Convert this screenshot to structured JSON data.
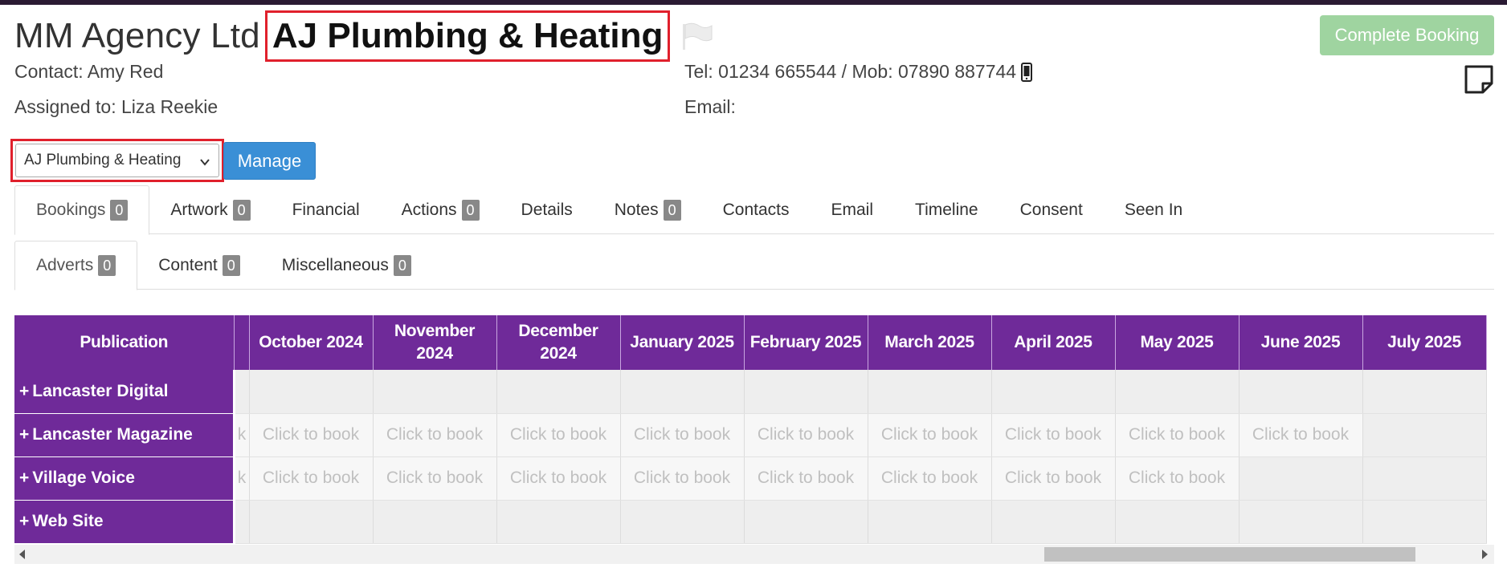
{
  "header": {
    "agency_name": "MM Agency Ltd",
    "client_name": "AJ Plumbing & Heating",
    "contact": "Contact: Amy Red",
    "assigned": "Assigned to: Liza Reekie",
    "tel": "Tel: 01234 665544 / Mob: 07890 887744",
    "email": "Email:",
    "complete_label": "Complete Booking"
  },
  "client_select": {
    "selected": "AJ Plumbing & Heating",
    "manage_label": "Manage"
  },
  "tabs": [
    {
      "label": "Bookings",
      "badge": "0"
    },
    {
      "label": "Artwork",
      "badge": "0"
    },
    {
      "label": "Financial",
      "badge": ""
    },
    {
      "label": "Actions",
      "badge": "0"
    },
    {
      "label": "Details",
      "badge": ""
    },
    {
      "label": "Notes",
      "badge": "0"
    },
    {
      "label": "Contacts",
      "badge": ""
    },
    {
      "label": "Email",
      "badge": ""
    },
    {
      "label": "Timeline",
      "badge": ""
    },
    {
      "label": "Consent",
      "badge": ""
    },
    {
      "label": "Seen In",
      "badge": ""
    }
  ],
  "subtabs": [
    {
      "label": "Adverts",
      "badge": "0"
    },
    {
      "label": "Content",
      "badge": "0"
    },
    {
      "label": "Miscellaneous",
      "badge": "0"
    }
  ],
  "grid": {
    "publication_header": "Publication",
    "months": [
      "October 2024",
      "November 2024",
      "December 2024",
      "January 2025",
      "February 2025",
      "March 2025",
      "April 2025",
      "May 2025",
      "June 2025",
      "July 2025"
    ],
    "book_text": "Click to book",
    "rows": [
      {
        "name": "Lancaster Digital",
        "cells": [
          "",
          "",
          "",
          "",
          "",
          "",
          "",
          "",
          "",
          ""
        ]
      },
      {
        "name": "Lancaster Magazine",
        "cells": [
          "Click to book",
          "Click to book",
          "Click to book",
          "Click to book",
          "Click to book",
          "Click to book",
          "Click to book",
          "Click to book",
          "Click to book",
          ""
        ]
      },
      {
        "name": "Village Voice",
        "cells": [
          "Click to book",
          "Click to book",
          "Click to book",
          "Click to book",
          "Click to book",
          "Click to book",
          "Click to book",
          "Click to book",
          "",
          ""
        ]
      },
      {
        "name": "Web Site",
        "cells": [
          "",
          "",
          "",
          "",
          "",
          "",
          "",
          "",
          "",
          ""
        ]
      }
    ]
  },
  "colors": {
    "header_purple": "#6f2a99",
    "complete_green": "#9fd4a0",
    "manage_blue": "#3a8fd6",
    "highlight_red": "#e0202c"
  },
  "icons": {
    "flag": "flag-icon",
    "mobile": "mobile-phone-icon",
    "note": "sticky-note-icon",
    "chevron": "chevron-down-icon"
  }
}
